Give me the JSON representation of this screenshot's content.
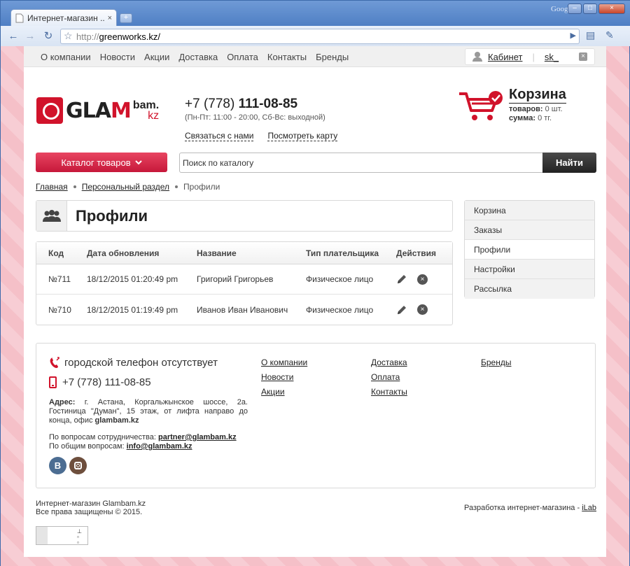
{
  "browser": {
    "tab_title": "Интернет-магазин ...",
    "tab_close": "×",
    "new_tab": "+",
    "google_label": "Google",
    "url_prefix": "http://",
    "url_host": "greenworks.kz/",
    "win_minimize": "–",
    "win_maximize": "□",
    "win_close": "×"
  },
  "topnav": {
    "links": [
      "О компании",
      "Новости",
      "Акции",
      "Доставка",
      "Оплата",
      "Контакты",
      "Бренды"
    ],
    "cabinet": "Кабинет",
    "user_short": "sk_",
    "close": "×"
  },
  "header": {
    "logo_main": "GLA",
    "logo_m": "M",
    "logo_bam": "bam.",
    "logo_kz": "kz",
    "phone_prefix": "+7 (778) ",
    "phone_number": "111-08-85",
    "hours": "(Пн-Пт: 11:00 - 20:00, Сб-Вс: выходной)",
    "link_contact": "Связаться с нами",
    "link_map": "Посмотреть карту"
  },
  "cart": {
    "title": "Корзина",
    "items_label": "товаров:",
    "items_value": "0 шт.",
    "sum_label": "сумма:",
    "sum_value": "0 тг."
  },
  "search": {
    "catalog_label": "Каталог товаров",
    "placeholder": "Поиск по каталогу",
    "button": "Найти"
  },
  "breadcrumb": {
    "home": "Главная",
    "section": "Персональный раздел",
    "current": "Профили"
  },
  "page_title": "Профили",
  "table": {
    "headers": [
      "Код",
      "Дата обновления",
      "Название",
      "Тип плательщика",
      "Действия"
    ],
    "rows": [
      {
        "code": "№711",
        "date": "18/12/2015 01:20:49 pm",
        "name": "Григорий Григорьев",
        "type": "Физическое лицо"
      },
      {
        "code": "№710",
        "date": "18/12/2015 01:19:49 pm",
        "name": "Иванов Иван Иванович",
        "type": "Физическое лицо"
      }
    ],
    "delete_symbol": "×"
  },
  "sidebar": {
    "items": [
      "Корзина",
      "Заказы",
      "Профили",
      "Настройки",
      "Рассылка"
    ]
  },
  "footer": {
    "city_phone": "городской телефон отсутствует",
    "mobile_phone": "+7 (778) 111-08-85",
    "address_label": "Адрес:",
    "address_text": " г. Астана, Коргальжынское шоссе, 2а. Гостиница \"Думан\", 15 этаж, от лифта направо до конца, офис ",
    "address_site": "glambam.kz",
    "coop_label": "По вопросам сотрудничества: ",
    "coop_email": "partner@glambam.kz",
    "general_label": "По общим вопросам: ",
    "general_email": "info@glambam.kz",
    "vk": "B",
    "col1": [
      "О компании",
      "Новости",
      "Акции"
    ],
    "col2": [
      "Доставка",
      "Оплата",
      "Контакты"
    ],
    "col3": [
      "Бренды"
    ]
  },
  "bottom": {
    "copyright_line1": "Интернет-магазин Glambam.kz",
    "copyright_line2": "Все права защищены © 2015.",
    "dev_text": "Разработка интернет-магазина - ",
    "dev_link": "iLab"
  },
  "colors": {
    "brand_red": "#d1132b",
    "search_button": "#222222",
    "page_pattern": "#f5c0c8"
  }
}
